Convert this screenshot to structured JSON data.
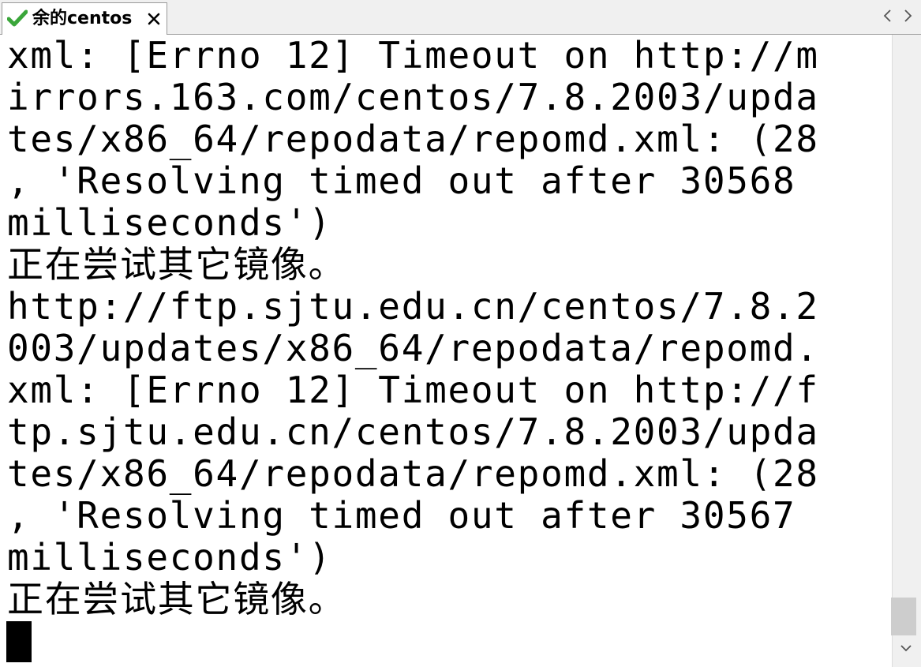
{
  "tab": {
    "title": "余的centos"
  },
  "terminal": {
    "lines": [
      "xml: [Errno 12] Timeout on http://m",
      "irrors.163.com/centos/7.8.2003/upda",
      "tes/x86_64/repodata/repomd.xml: (28",
      ", 'Resolving timed out after 30568",
      "milliseconds')",
      "正在尝试其它镜像。",
      "http://ftp.sjtu.edu.cn/centos/7.8.2",
      "003/updates/x86_64/repodata/repomd.",
      "xml: [Errno 12] Timeout on http://f",
      "tp.sjtu.edu.cn/centos/7.8.2003/upda",
      "tes/x86_64/repodata/repomd.xml: (28",
      ", 'Resolving timed out after 30567",
      "milliseconds')",
      "正在尝试其它镜像。"
    ]
  },
  "icons": {
    "tab_status": "checkmark-icon",
    "tab_close": "close-icon",
    "scroll_left": "chevron-left-icon",
    "scroll_right": "chevron-right-icon",
    "scroll_down": "chevron-down-icon"
  },
  "colors": {
    "terminal_background": "#ffffff",
    "terminal_text": "#000000",
    "checkmark": "#3aa63a"
  }
}
